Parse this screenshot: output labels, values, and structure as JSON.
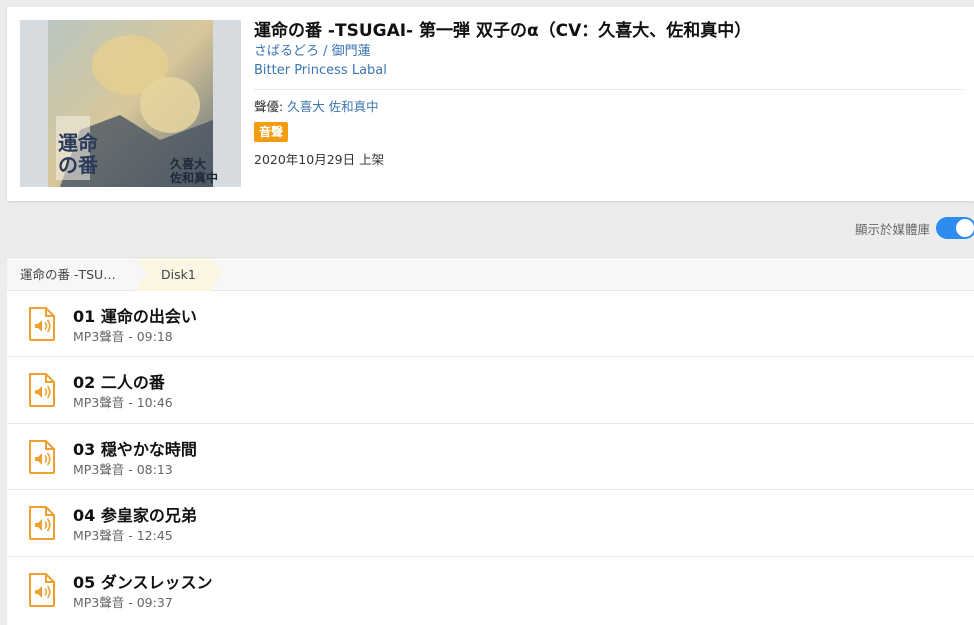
{
  "album": {
    "title": "運命の番 -TSUGAI- 第一弾 双子のα（CV：久喜大、佐和真中）",
    "author": "さばるどろ / 御門蓮",
    "publisher": "Bitter Princess Labal",
    "cv_label": "聲優: ",
    "cv_names": "久喜大 佐和真中",
    "badge": "音聲",
    "release": "2020年10月29日 上架"
  },
  "library_toggle": {
    "label": "顯示於媒體庫",
    "on": true
  },
  "breadcrumb": {
    "items": [
      "運命の番 -TSU…",
      "Disk1"
    ]
  },
  "tracks": [
    {
      "title": "01 運命の出会い",
      "meta": "MP3聲音 - 09:18"
    },
    {
      "title": "02 二人の番",
      "meta": "MP3聲音 - 10:46"
    },
    {
      "title": "03 穏やかな時間",
      "meta": "MP3聲音 - 08:13"
    },
    {
      "title": "04 参皇家の兄弟",
      "meta": "MP3聲音 - 12:45"
    },
    {
      "title": "05 ダンスレッスン",
      "meta": "MP3聲音 - 09:37"
    }
  ],
  "colors": {
    "accent": "#2d8cf0",
    "badge": "#f39c12",
    "link": "#3a76b2",
    "audio_icon": "#f0a030"
  },
  "icons": {
    "track": "audio-file-icon"
  }
}
